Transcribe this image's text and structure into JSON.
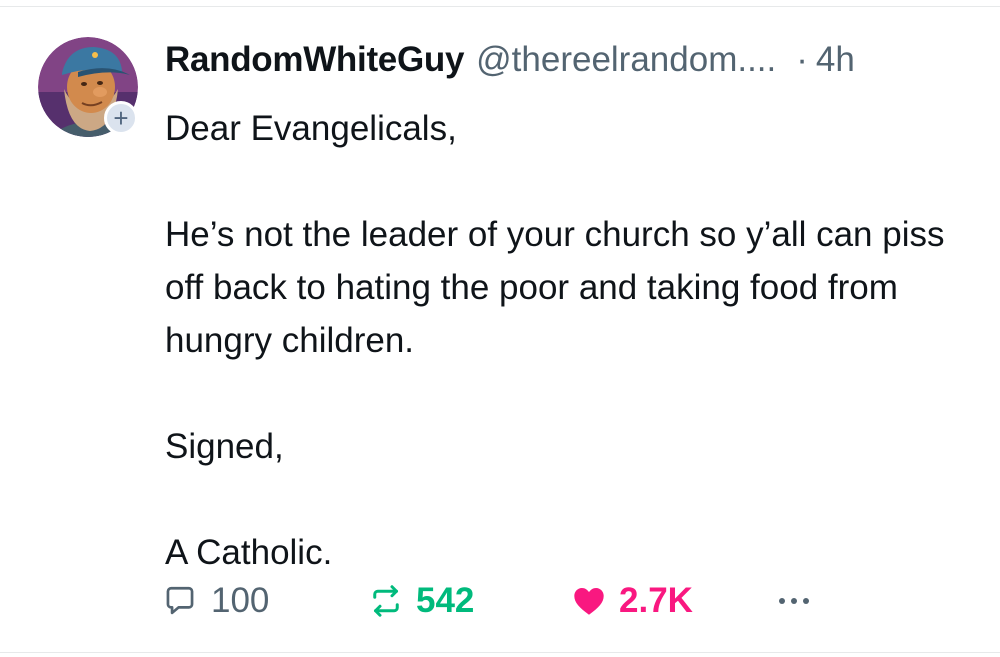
{
  "tweet": {
    "author": {
      "display_name": "RandomWhiteGuy",
      "handle": "@thereelrandom....",
      "avatar_icon": "avatar-bearded-man-cap",
      "follow_icon": "+"
    },
    "separator": "·",
    "timestamp": "4h",
    "lines": [
      "Dear Evangelicals,",
      "",
      "He’s not the leader of your church so y’all can piss off back to hating the poor and taking food from hungry children.",
      "",
      "Signed,",
      "",
      "A Catholic."
    ],
    "stats": {
      "replies": "100",
      "reposts": "542",
      "likes": "2.7K"
    }
  },
  "colors": {
    "text": "#0f1419",
    "muted": "#536471",
    "repost": "#00ba7c",
    "like": "#f91880",
    "divider": "#e7e9ea"
  }
}
